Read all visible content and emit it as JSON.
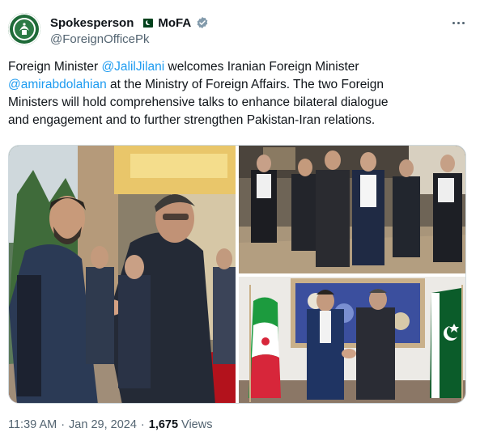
{
  "author": {
    "display_name": "Spokesperson",
    "org_label": "MoFA",
    "handle": "@ForeignOfficePk",
    "flag_icon": "pakistan-flag-icon",
    "verified_icon": "verified-badge-icon",
    "verified_color": "#829aab"
  },
  "tweet": {
    "text_part_1": "Foreign Minister ",
    "mention_1": "@JalilJilani",
    "text_part_2": " welcomes Iranian Foreign Minister",
    "mention_2": "@amirabdolahian",
    "text_part_3": " at the Ministry of Foreign Affairs. The two Foreign",
    "text_line_3": "Ministers will hold comprehensive talks to enhance bilateral dialogue",
    "text_line_4": "and engagement and to further strengthen Pakistan-Iran relations."
  },
  "media": {
    "photo_count": 3,
    "photos": [
      "handshake-photo",
      "walking-delegation-photo",
      "flags-handshake-photo"
    ]
  },
  "meta": {
    "time": "11:39 AM",
    "date": "Jan 29, 2024",
    "views_count": "1,675",
    "views_label": "Views"
  },
  "colors": {
    "link": "#1d9bf0",
    "text": "#0f1419",
    "muted": "#536471"
  }
}
